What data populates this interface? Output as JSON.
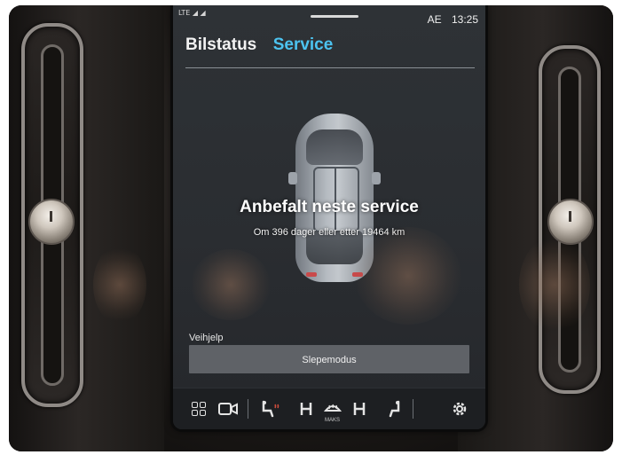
{
  "status_bar": {
    "network": "LTE ◢ ◢",
    "indicator": "AE",
    "time": "13:25"
  },
  "tabs": [
    {
      "label": "Bilstatus",
      "active": false
    },
    {
      "label": "Service",
      "active": true
    }
  ],
  "service": {
    "headline": "Anbefalt neste service",
    "detail": "Om 396 dager eller etter 19464 km"
  },
  "roadside": {
    "section_label": "Veihjelp",
    "tow_mode_button": "Slepemodus"
  },
  "dock": {
    "climate_label": "MAKS"
  },
  "colors": {
    "accent": "#4cc3f0",
    "screen_bg": "#2c2f33",
    "button_bg": "#5f6267"
  }
}
